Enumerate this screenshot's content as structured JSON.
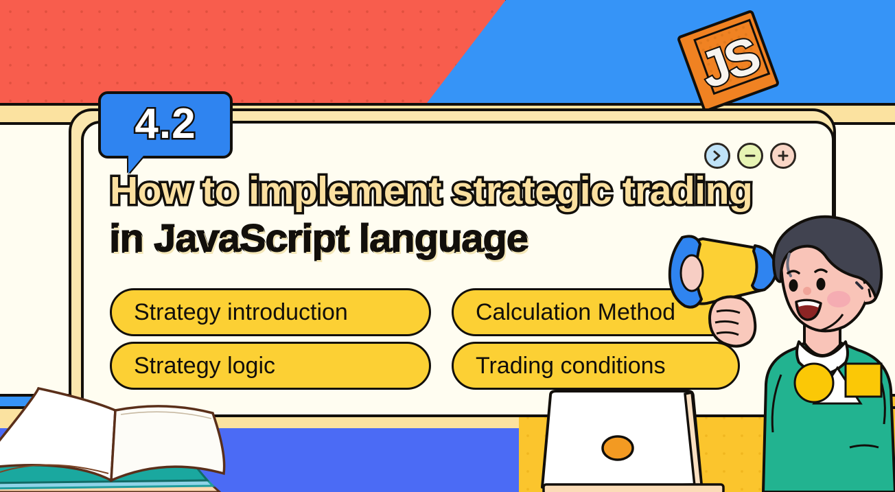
{
  "slide": {
    "number_badge": "4.2",
    "title_line1": "How to implement strategic trading",
    "title_line2": "in JavaScript language"
  },
  "window_controls": [
    {
      "name": "next",
      "icon": "chevron-right-icon",
      "color": "#bfe2f7"
    },
    {
      "name": "minimize",
      "icon": "minus-icon",
      "color": "#e7f4b4"
    },
    {
      "name": "add",
      "icon": "plus-icon",
      "color": "#f9d6c6"
    }
  ],
  "topics": [
    {
      "label": "Strategy introduction"
    },
    {
      "label": "Calculation Method"
    },
    {
      "label": "Strategy logic"
    },
    {
      "label": "Trading conditions"
    }
  ],
  "logo": {
    "text": "JS"
  },
  "illustrations": [
    {
      "name": "megaphone-illustration"
    },
    {
      "name": "character-illustration"
    },
    {
      "name": "laptop-illustration"
    },
    {
      "name": "open-book-illustration"
    }
  ],
  "colors": {
    "red": "#f85d4d",
    "blue": "#3694f7",
    "royal_blue": "#4b6bf5",
    "yellow": "#fbc52d",
    "pill_yellow": "#fcd034",
    "cream": "#fffdf1",
    "tan": "#fbe2a0",
    "outline": "#120f0b",
    "js_orange": "#f08222",
    "badge_blue": "#2f84f0",
    "sweater_green": "#22b390",
    "skin": "#f9c4b8",
    "hair": "#414350"
  }
}
